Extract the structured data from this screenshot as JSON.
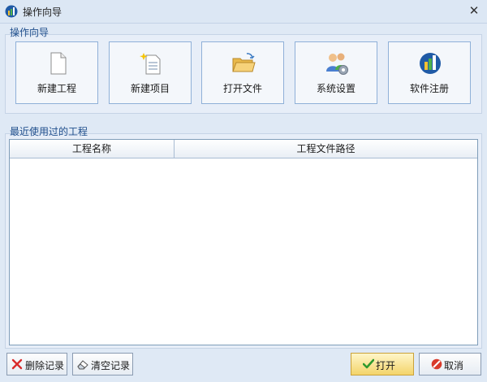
{
  "window": {
    "title": "操作向导",
    "close_symbol": "✕"
  },
  "wizard": {
    "group_title": "操作向导",
    "tiles": [
      {
        "label": "新建工程",
        "icon": "new-document-icon"
      },
      {
        "label": "新建项目",
        "icon": "new-project-icon"
      },
      {
        "label": "打开文件",
        "icon": "open-folder-icon"
      },
      {
        "label": "系统设置",
        "icon": "users-settings-icon"
      },
      {
        "label": "软件注册",
        "icon": "app-logo-icon"
      }
    ]
  },
  "recent": {
    "group_title": "最近使用过的工程",
    "columns": [
      "工程名称",
      "工程文件路径"
    ],
    "rows": []
  },
  "footer": {
    "delete_label": "删除记录",
    "clear_label": "清空记录",
    "open_label": "打开",
    "cancel_label": "取消"
  },
  "colors": {
    "accent": "#1f4e8c",
    "background": "#dfe9f5",
    "open_button": "#f3d46a"
  }
}
